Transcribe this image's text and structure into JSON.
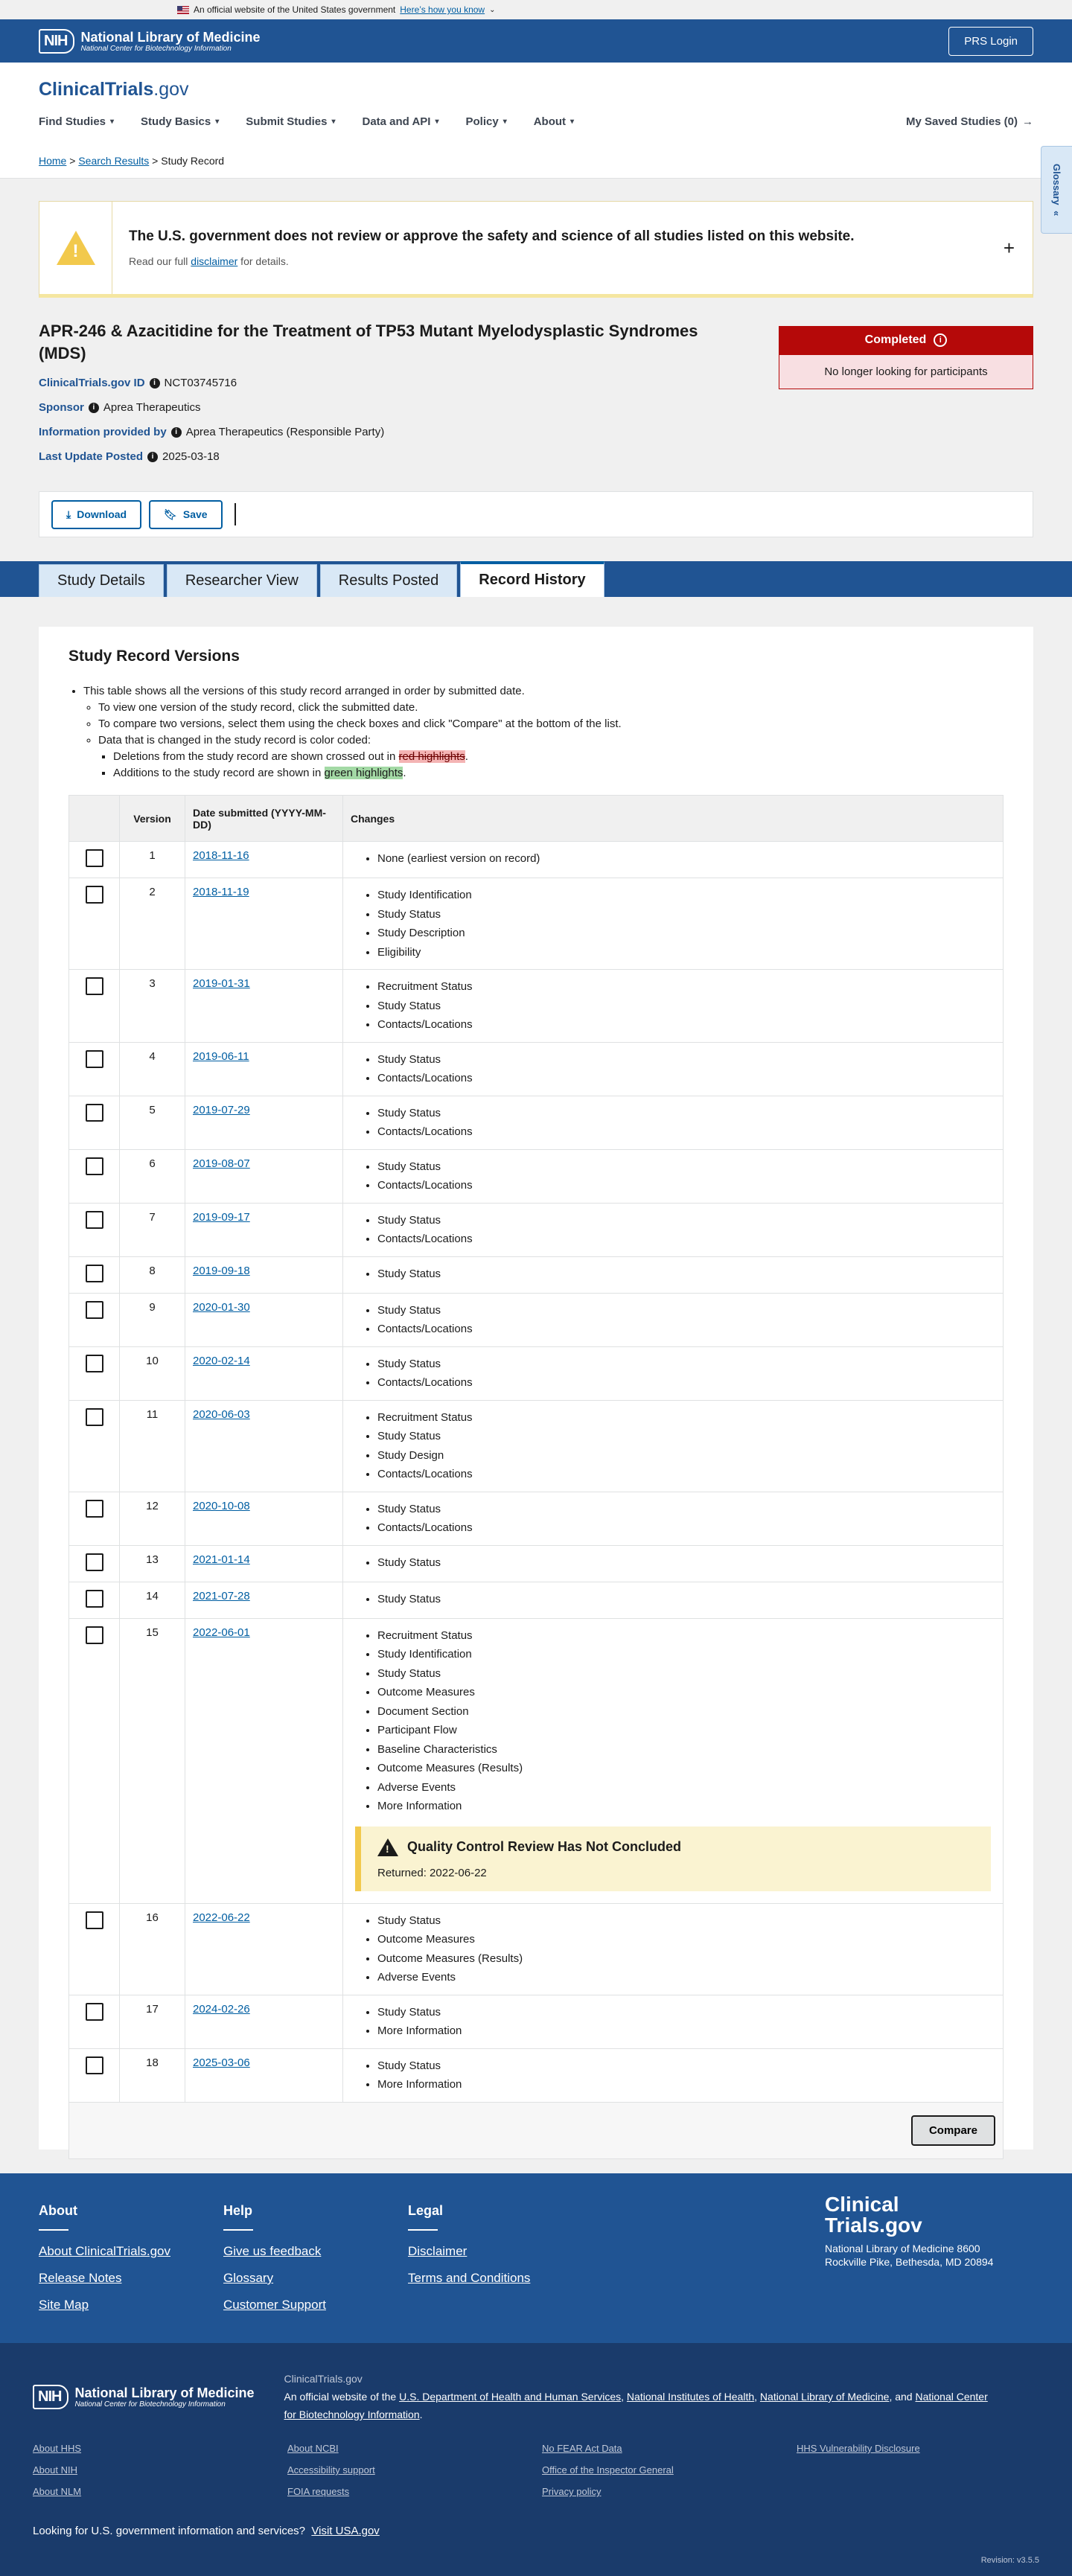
{
  "gov_banner": {
    "text": "An official website of the United States government",
    "link": "Here’s how you know"
  },
  "nih": {
    "logo": "NIH",
    "title": "National Library of Medicine",
    "subtitle": "National Center for Biotechnology Information",
    "prs_login": "PRS Login"
  },
  "header": {
    "logo_bold": "ClinicalTrials",
    "logo_rest": ".gov",
    "nav": [
      "Find Studies",
      "Study Basics",
      "Submit Studies",
      "Data and API",
      "Policy",
      "About"
    ],
    "saved": "My Saved Studies (0)"
  },
  "breadcrumb": {
    "home": "Home",
    "search": "Search Results",
    "current": "Study Record"
  },
  "glossary": "Glossary",
  "disclaimer": {
    "heading": "The U.S. government does not review or approve the safety and science of all studies listed on this website.",
    "pre": "Read our full ",
    "link": "disclaimer",
    "post": " for details."
  },
  "study": {
    "title": "APR-246 & Azacitidine for the Treatment of TP53 Mutant Myelodysplastic Syndromes (MDS)",
    "id_label": "ClinicalTrials.gov ID",
    "id": "NCT03745716",
    "sponsor_label": "Sponsor",
    "sponsor": "Aprea Therapeutics",
    "info_label": "Information provided by",
    "info": "Aprea Therapeutics (Responsible Party)",
    "updated_label": "Last Update Posted",
    "updated": "2025-03-18",
    "status": "Completed",
    "status_note": "No longer looking for participants"
  },
  "actions": {
    "download": "Download",
    "save": "Save"
  },
  "tabs": [
    "Study Details",
    "Researcher View",
    "Results Posted",
    "Record History"
  ],
  "versions": {
    "heading": "Study Record Versions",
    "intro1": "This table shows all the versions of this study record arranged in order by submitted date.",
    "intro2": "To view one version of the study record, click the submitted date.",
    "intro3": "To compare two versions, select them using the check boxes and click \"Compare\" at the bottom of the list.",
    "intro4": "Data that is changed in the study record is color coded:",
    "intro5_pre": "Deletions from the study record are shown crossed out in ",
    "intro5_hl": "red highlights",
    "intro6_pre": "Additions to the study record are shown in ",
    "intro6_hl": "green highlights",
    "col_version": "Version",
    "col_date": "Date submitted (YYYY-MM-DD)",
    "col_changes": "Changes",
    "rows": [
      {
        "v": "1",
        "d": "2018-11-16",
        "c": [
          "None (earliest version on record)"
        ]
      },
      {
        "v": "2",
        "d": "2018-11-19",
        "c": [
          "Study Identification",
          "Study Status",
          "Study Description",
          "Eligibility"
        ]
      },
      {
        "v": "3",
        "d": "2019-01-31",
        "c": [
          "Recruitment Status",
          "Study Status",
          "Contacts/Locations"
        ]
      },
      {
        "v": "4",
        "d": "2019-06-11",
        "c": [
          "Study Status",
          "Contacts/Locations"
        ]
      },
      {
        "v": "5",
        "d": "2019-07-29",
        "c": [
          "Study Status",
          "Contacts/Locations"
        ]
      },
      {
        "v": "6",
        "d": "2019-08-07",
        "c": [
          "Study Status",
          "Contacts/Locations"
        ]
      },
      {
        "v": "7",
        "d": "2019-09-17",
        "c": [
          "Study Status",
          "Contacts/Locations"
        ]
      },
      {
        "v": "8",
        "d": "2019-09-18",
        "c": [
          "Study Status"
        ]
      },
      {
        "v": "9",
        "d": "2020-01-30",
        "c": [
          "Study Status",
          "Contacts/Locations"
        ]
      },
      {
        "v": "10",
        "d": "2020-02-14",
        "c": [
          "Study Status",
          "Contacts/Locations"
        ]
      },
      {
        "v": "11",
        "d": "2020-06-03",
        "c": [
          "Recruitment Status",
          "Study Status",
          "Study Design",
          "Contacts/Locations"
        ]
      },
      {
        "v": "12",
        "d": "2020-10-08",
        "c": [
          "Study Status",
          "Contacts/Locations"
        ]
      },
      {
        "v": "13",
        "d": "2021-01-14",
        "c": [
          "Study Status"
        ]
      },
      {
        "v": "14",
        "d": "2021-07-28",
        "c": [
          "Study Status"
        ]
      },
      {
        "v": "15",
        "d": "2022-06-01",
        "c": [
          "Recruitment Status",
          "Study Identification",
          "Study Status",
          "Outcome Measures",
          "Document Section",
          "Participant Flow",
          "Baseline Characteristics",
          "Outcome Measures (Results)",
          "Adverse Events",
          "More Information"
        ],
        "qc": {
          "title": "Quality Control Review Has Not Concluded",
          "returned": "Returned: 2022-06-22"
        }
      },
      {
        "v": "16",
        "d": "2022-06-22",
        "c": [
          "Study Status",
          "Outcome Measures",
          "Outcome Measures (Results)",
          "Adverse Events"
        ]
      },
      {
        "v": "17",
        "d": "2024-02-26",
        "c": [
          "Study Status",
          "More Information"
        ]
      },
      {
        "v": "18",
        "d": "2025-03-06",
        "c": [
          "Study Status",
          "More Information"
        ]
      }
    ],
    "compare": "Compare"
  },
  "footer": {
    "about_h": "About",
    "about": [
      "About ClinicalTrials.gov",
      "Release Notes",
      "Site Map"
    ],
    "help_h": "Help",
    "help": [
      "Give us feedback",
      "Glossary",
      "Customer Support"
    ],
    "legal_h": "Legal",
    "legal": [
      "Disclaimer",
      "Terms and Conditions"
    ],
    "logo_l1": "Clinical",
    "logo_l2": "Trials.gov",
    "address": "National Library of Medicine 8600 Rockville Pike, Bethesda, MD 20894"
  },
  "footer2": {
    "label": "ClinicalTrials.gov",
    "desc_pre": "An official website of the ",
    "l1": "U.S. Department of Health and Human Services",
    "l2": "National Institutes of Health",
    "l3": "National Library of Medicine",
    "l4": "National Center for Biotechnology Information",
    "links": [
      [
        "About HHS",
        "About NIH",
        "About NLM"
      ],
      [
        "About NCBI",
        "Accessibility support",
        "FOIA requests"
      ],
      [
        "No FEAR Act Data",
        "Office of the Inspector General",
        "Privacy policy"
      ],
      [
        "HHS Vulnerability Disclosure"
      ]
    ],
    "usa_pre": "Looking for U.S. government information and services?",
    "usa_link": "Visit USA.gov",
    "revision": "Revision: v3.5.5"
  }
}
